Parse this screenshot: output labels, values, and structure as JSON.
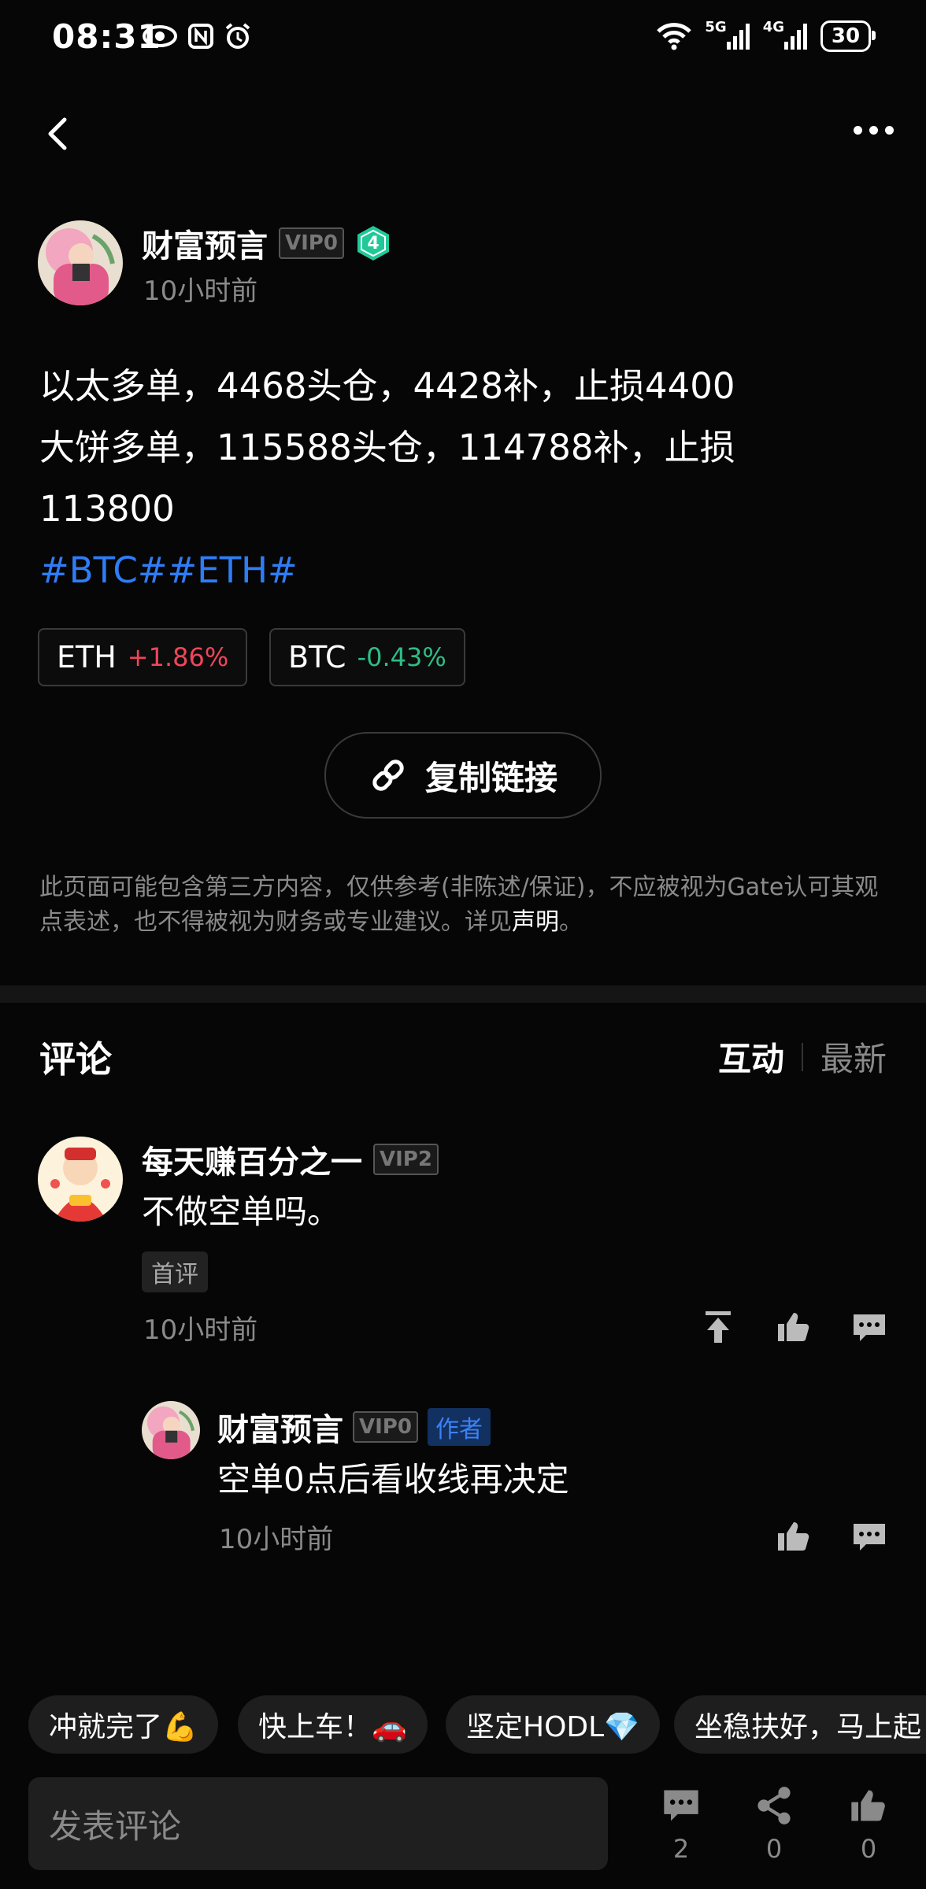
{
  "status_bar": {
    "time": "08:31",
    "signal_5g": "5G",
    "signal_4g": "4G",
    "battery": "30"
  },
  "post": {
    "author": {
      "name": "财富预言",
      "vip": "VIP0",
      "level": "4",
      "time": "10小时前"
    },
    "lines": [
      "以太多单，4468头仓，4428补，止损4400",
      "大饼多单，115588头仓，114788补，止损",
      "113800"
    ],
    "tags": "#BTC##ETH#",
    "tickers": [
      {
        "symbol": "ETH",
        "change": "+1.86%"
      },
      {
        "symbol": "BTC",
        "change": "-0.43%"
      }
    ],
    "copy_link_label": "复制链接",
    "disclaimer_text": "此页面可能包含第三方内容，仅供参考(非陈述/保证)，不应被视为Gate认可其观点表述，也不得被视为财务或专业建议。详见",
    "disclaimer_link": "声明",
    "disclaimer_end": "。"
  },
  "comments_section": {
    "title": "评论",
    "sort_options": [
      "互动",
      "最新"
    ]
  },
  "comments": [
    {
      "name": "每天赚百分之一",
      "vip": "VIP2",
      "text": "不做空单吗。",
      "badge": "首评",
      "time": "10小时前"
    }
  ],
  "reply": {
    "name": "财富预言",
    "vip": "VIP0",
    "tag": "作者",
    "text": "空单0点后看收线再决定",
    "time": "10小时前"
  },
  "quick_replies": [
    "冲就完了💪",
    "快上车！🚗",
    "坚定HODL💎",
    "坐稳扶好，马上起"
  ],
  "bottom_bar": {
    "placeholder": "发表评论",
    "comments_count": "2",
    "shares_count": "0",
    "likes_count": "0"
  },
  "colors": {
    "accent_blue": "#2f7df6",
    "up_red": "#f0455a",
    "down_green": "#2ebd85",
    "level_badge": "#20c997"
  }
}
